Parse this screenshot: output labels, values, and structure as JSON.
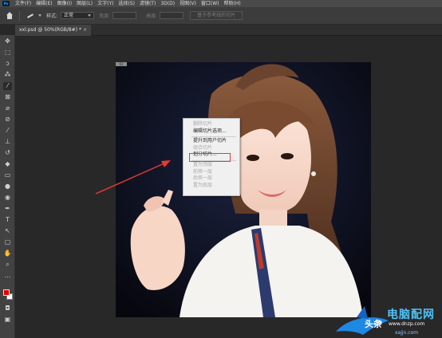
{
  "app": {
    "logo": "Ps"
  },
  "menu": [
    "文件(F)",
    "编辑(E)",
    "图像(I)",
    "图层(L)",
    "文字(Y)",
    "选择(S)",
    "滤镜(T)",
    "3D(D)",
    "视图(V)",
    "窗口(W)",
    "帮助(H)"
  ],
  "options": {
    "style_label": "样式:",
    "style_value": "正常",
    "width_label": "宽度:",
    "height_label": "高度:",
    "guides_button": "基于参考线的切片"
  },
  "document": {
    "tab_title": "xxl.psd @ 50%(RGB/8#) *",
    "close": "×"
  },
  "context_menu": {
    "items": [
      {
        "label": "删除切片",
        "enabled": false
      },
      {
        "label": "编辑切片选项...",
        "enabled": true
      },
      {
        "label": "提升到用户切片",
        "enabled": true
      },
      {
        "label": "组合切片",
        "enabled": false
      },
      {
        "label": "划分切片...",
        "enabled": true
      },
      {
        "label": "置为顶层",
        "enabled": false
      },
      {
        "label": "前移一层",
        "enabled": false
      },
      {
        "label": "后移一层",
        "enabled": false
      },
      {
        "label": "置为底层",
        "enabled": false
      }
    ],
    "highlighted": "划分切片..."
  },
  "colors": {
    "foreground": "#e00000",
    "background": "#ffffff",
    "highlight_box": "#e53935",
    "arrow": "#e53935"
  },
  "tools": [
    "move-icon",
    "marquee-icon",
    "lasso-icon",
    "quick-select-icon",
    "slice-icon",
    "frame-icon",
    "eyedropper-icon",
    "spot-heal-icon",
    "brush-icon",
    "stamp-icon",
    "history-brush-icon",
    "eraser-icon",
    "gradient-icon",
    "blur-icon",
    "dodge-icon",
    "pen-icon",
    "type-icon",
    "path-select-icon",
    "shape-icon",
    "hand-icon",
    "zoom-icon",
    "more-icon"
  ],
  "watermark": {
    "line1": "头条",
    "line2": "www.dnzp.com",
    "brand": "电脑配网",
    "site": "xajjn.com"
  }
}
